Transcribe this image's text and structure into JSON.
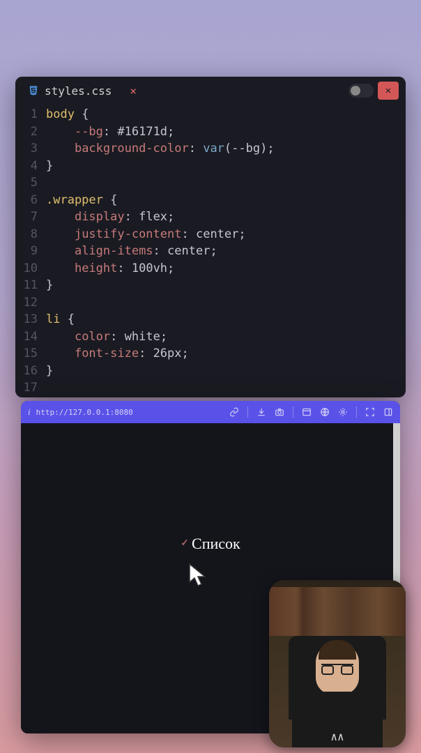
{
  "editor": {
    "tab": {
      "filename": "styles.css",
      "icon": "css3-icon"
    },
    "lines": [
      {
        "n": "1",
        "tokens": [
          [
            "sel",
            "body "
          ],
          [
            "brace",
            "{"
          ]
        ]
      },
      {
        "n": "2",
        "tokens": [
          [
            "ind",
            "    "
          ],
          [
            "prop",
            "--bg"
          ],
          [
            "punc",
            ": "
          ],
          [
            "val",
            "#16171d"
          ],
          [
            "punc",
            ";"
          ]
        ]
      },
      {
        "n": "3",
        "tokens": [
          [
            "ind",
            "    "
          ],
          [
            "prop",
            "background-color"
          ],
          [
            "punc",
            ": "
          ],
          [
            "func",
            "var"
          ],
          [
            "punc",
            "("
          ],
          [
            "val",
            "--bg"
          ],
          [
            "punc",
            ");"
          ]
        ]
      },
      {
        "n": "4",
        "tokens": [
          [
            "brace",
            "}"
          ]
        ]
      },
      {
        "n": "5",
        "tokens": []
      },
      {
        "n": "6",
        "tokens": [
          [
            "sel",
            ".wrapper "
          ],
          [
            "brace",
            "{"
          ]
        ]
      },
      {
        "n": "7",
        "tokens": [
          [
            "ind",
            "    "
          ],
          [
            "prop",
            "display"
          ],
          [
            "punc",
            ": "
          ],
          [
            "val",
            "flex"
          ],
          [
            "punc",
            ";"
          ]
        ]
      },
      {
        "n": "8",
        "tokens": [
          [
            "ind",
            "    "
          ],
          [
            "prop",
            "justify-content"
          ],
          [
            "punc",
            ": "
          ],
          [
            "val",
            "center"
          ],
          [
            "punc",
            ";"
          ]
        ]
      },
      {
        "n": "9",
        "tokens": [
          [
            "ind",
            "    "
          ],
          [
            "prop",
            "align-items"
          ],
          [
            "punc",
            ": "
          ],
          [
            "val",
            "center"
          ],
          [
            "punc",
            ";"
          ]
        ]
      },
      {
        "n": "10",
        "tokens": [
          [
            "ind",
            "    "
          ],
          [
            "prop",
            "height"
          ],
          [
            "punc",
            ": "
          ],
          [
            "val",
            "100vh"
          ],
          [
            "punc",
            ";"
          ]
        ]
      },
      {
        "n": "11",
        "tokens": [
          [
            "brace",
            "}"
          ]
        ]
      },
      {
        "n": "12",
        "tokens": []
      },
      {
        "n": "13",
        "tokens": [
          [
            "sel",
            "li "
          ],
          [
            "brace",
            "{"
          ]
        ]
      },
      {
        "n": "14",
        "tokens": [
          [
            "ind",
            "    "
          ],
          [
            "prop",
            "color"
          ],
          [
            "punc",
            ": "
          ],
          [
            "val",
            "white"
          ],
          [
            "punc",
            ";"
          ]
        ]
      },
      {
        "n": "15",
        "tokens": [
          [
            "ind",
            "    "
          ],
          [
            "prop",
            "font-size"
          ],
          [
            "punc",
            ": "
          ],
          [
            "val",
            "26px"
          ],
          [
            "punc",
            ";"
          ]
        ]
      },
      {
        "n": "16",
        "tokens": [
          [
            "brace",
            "}"
          ]
        ]
      },
      {
        "n": "17",
        "tokens": []
      }
    ]
  },
  "browser": {
    "url": "http://127.0.0.1:8080",
    "content_text": "Список"
  }
}
